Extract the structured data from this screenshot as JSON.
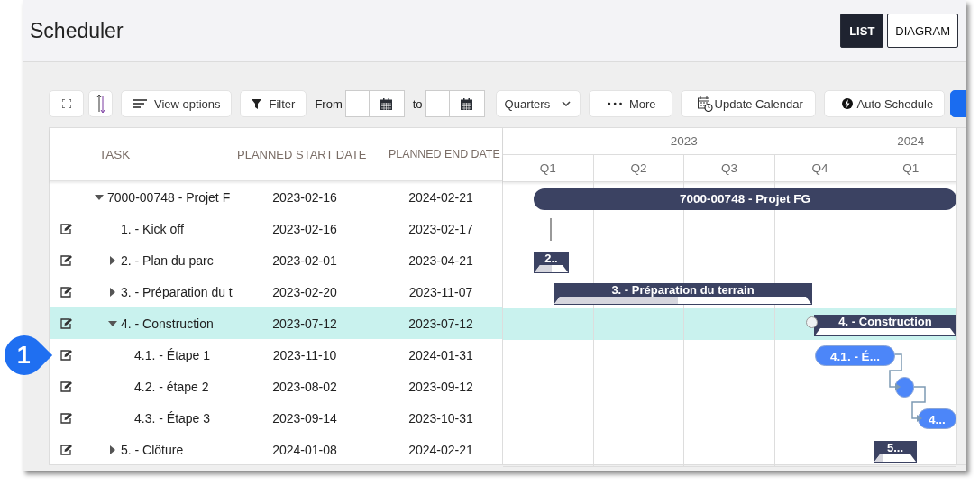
{
  "app": {
    "title": "Scheduler"
  },
  "view_switch": [
    {
      "label": "LIST",
      "selected": true
    },
    {
      "label": "DIAGRAM",
      "selected": false
    }
  ],
  "toolbar": {
    "view_options": "View options",
    "filter": "Filter",
    "from_label": "From",
    "to_label": "to",
    "scale": {
      "value": "Quarters"
    },
    "more": "More",
    "update_calendar": "Update Calendar",
    "auto_schedule": "Auto Schedule"
  },
  "table": {
    "columns": [
      "TASK",
      "PLANNED START DATE",
      "PLANNED END DATE"
    ],
    "rows": [
      {
        "task": "7000-00748 - Projet F",
        "start": "2023-02-16",
        "end": "2024-02-21",
        "selected": false,
        "editable": false,
        "expanded": true,
        "bar": {
          "kind": "summary",
          "label": "7000-00748 - Projet FG"
        },
        "children": [
          {
            "task": "1. - Kick off",
            "start": "2023-02-16",
            "end": "2023-02-17",
            "selected": false,
            "editable": true,
            "bar": {
              "kind": "milestone"
            }
          },
          {
            "task": "2. - Plan du parc",
            "start": "2023-02-01",
            "end": "2023-04-21",
            "selected": false,
            "editable": true,
            "expanded": false,
            "bar": {
              "kind": "parent",
              "label": "2..",
              "level": 0.5
            }
          },
          {
            "task": "3. - Préparation du t",
            "start": "2023-02-20",
            "end": "2023-11-07",
            "selected": false,
            "editable": true,
            "expanded": false,
            "bar": {
              "kind": "parent",
              "label": "3. - Préparation du terrain",
              "level": 0.48
            }
          },
          {
            "task": "4. - Construction",
            "start": "2023-07-12",
            "end": "2023-07-12",
            "selected": true,
            "editable": true,
            "expanded": true,
            "bar": {
              "kind": "parent",
              "label": "4. - Construction"
            },
            "children": [
              {
                "task": "4.1. - Étape 1",
                "start": "2023-11-10",
                "end": "2024-01-31",
                "selected": false,
                "editable": true,
                "bar": {
                  "kind": "task",
                  "label": "4.1. - É..."
                }
              },
              {
                "task": "4.2. - étape 2",
                "start": "2023-08-02",
                "end": "2023-09-12",
                "selected": false,
                "editable": true,
                "bar": {
                  "kind": "task"
                }
              },
              {
                "task": "4.3. - Étape 3",
                "start": "2023-09-14",
                "end": "2023-10-31",
                "selected": false,
                "editable": true,
                "bar": {
                  "kind": "task",
                  "label": "4..."
                }
              }
            ]
          },
          {
            "task": "5. - Clôture",
            "start": "2024-01-08",
            "end": "2024-02-21",
            "selected": false,
            "editable": true,
            "expanded": false,
            "bar": {
              "kind": "parent",
              "label": "5...",
              "level": 0.2
            }
          }
        ]
      }
    ]
  },
  "timeline": {
    "years": [
      {
        "label": "2023",
        "quarters": [
          "Q1",
          "Q2",
          "Q3",
          "Q4"
        ]
      },
      {
        "label": "2024",
        "quarters": [
          "Q1"
        ]
      }
    ]
  },
  "callout": {
    "label": "1"
  }
}
